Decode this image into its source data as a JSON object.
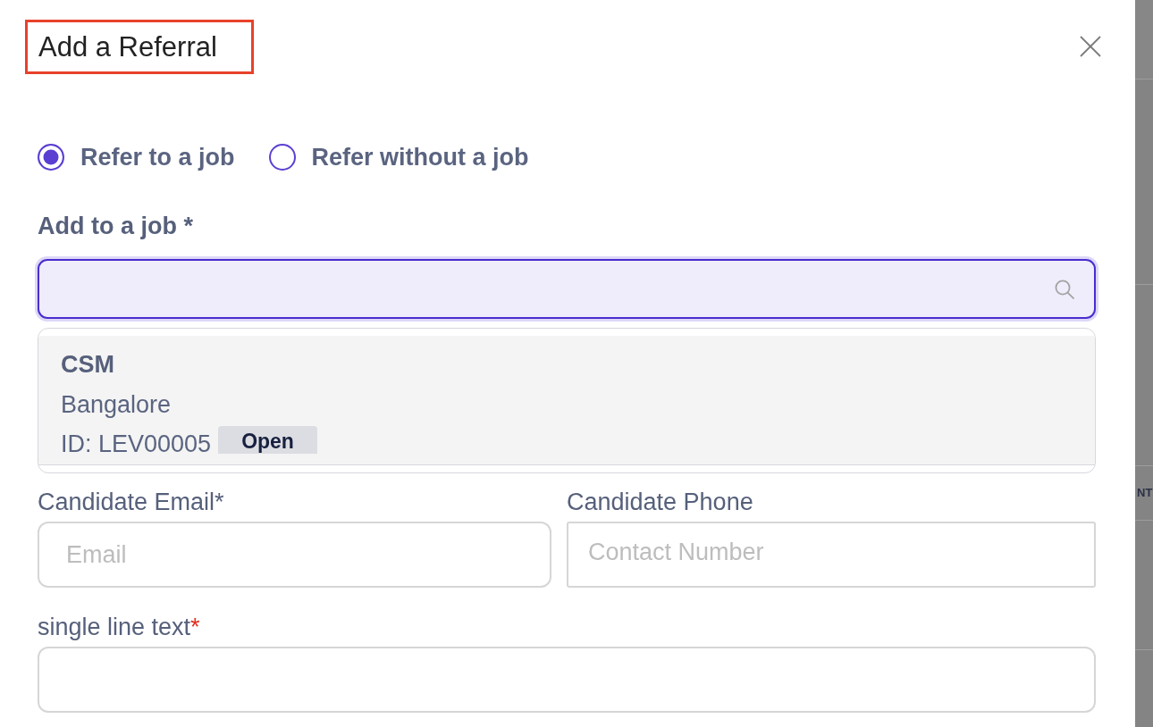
{
  "dialog": {
    "title": {
      "text": "Add a Referral",
      "highlighted": true
    },
    "referral_options": [
      {
        "label": "Refer to a job",
        "selected": true
      },
      {
        "label": "Refer without a job",
        "selected": false
      }
    ],
    "job_picker": {
      "label": "Add to a job *",
      "focused": true,
      "results": [
        {
          "title": "CSM",
          "location": "Bangalore",
          "job_id": "ID: LEV00005",
          "status": "Open"
        }
      ]
    },
    "candidate_fields": [
      {
        "kind": "email",
        "label": "Candidate Email*",
        "placeholder": "Email"
      },
      {
        "kind": "phone",
        "label": "Candidate Phone",
        "placeholder": "Contact Number"
      }
    ],
    "custom_field": {
      "label": "single line text",
      "required_mark": "*"
    }
  },
  "background_page": {
    "text_fragment": "NT"
  }
}
